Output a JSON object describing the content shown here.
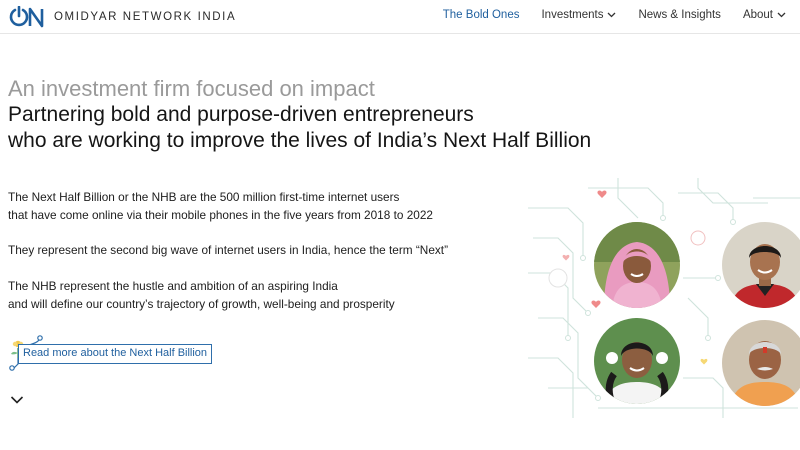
{
  "brand": {
    "logo_letters": "ON",
    "name": "OMIDYAR NETWORK INDIA"
  },
  "nav": {
    "items": [
      {
        "label": "The Bold Ones",
        "active": true,
        "dropdown": false
      },
      {
        "label": "Investments",
        "active": false,
        "dropdown": true
      },
      {
        "label": "News & Insights",
        "active": false,
        "dropdown": false
      },
      {
        "label": "About",
        "active": false,
        "dropdown": true
      }
    ]
  },
  "hero": {
    "tagline": "An investment firm focused on impact",
    "headline_line1": "Partnering bold and purpose-driven entrepreneurs",
    "headline_line2": "who are working to improve the lives of India’s Next Half Billion"
  },
  "body": {
    "p1_line1": "The Next Half Billion or the NHB are the 500 million first-time internet users",
    "p1_line2": "that have come online via their mobile phones in the five years from 2018 to 2022",
    "p2": "They represent the second big wave of internet users in India, hence the term “Next”",
    "p3_line1": "The NHB represent the hustle and ambition of an aspiring India",
    "p3_line2": "and will define our country’s trajectory of growth, well-being and prosperity"
  },
  "cta": {
    "label": "Read more about the Next Half Billion"
  },
  "icons": {
    "scroll": "chevron-down-icon",
    "cta_decoration": "sprout-icon",
    "nav_dropdown": "chevron-down-icon"
  },
  "colors": {
    "accent": "#1f5f9e",
    "text": "#1e1e1e",
    "muted": "#9a9a9a",
    "circuit": "#cfe3dc",
    "heart": "#ef8a8a"
  }
}
